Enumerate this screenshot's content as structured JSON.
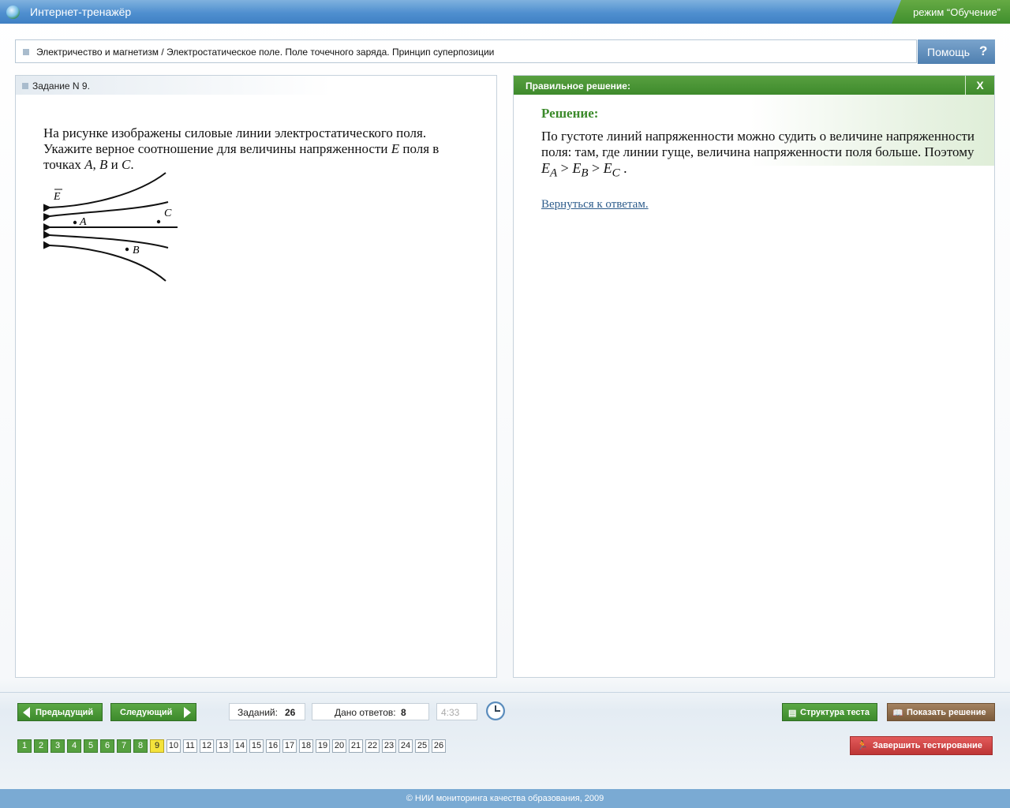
{
  "app": {
    "title": "Интернет-тренажёр",
    "mode": "режим “Обучение”"
  },
  "breadcrumb": {
    "text": "Электричество и магнетизм / Электростатическое поле. Поле точечного заряда. Принцип суперпозиции"
  },
  "help": {
    "label": "Помощь",
    "icon": "question-icon",
    "icon_text": "?"
  },
  "task": {
    "header": "Задание N 9.",
    "question": {
      "p1": "На рисунке изображены силовые линии электростатического поля. Укажите верное соотношение для величины напряженности ",
      "E": "E",
      "p2": " поля в точках ",
      "A": "A",
      "comma": ", ",
      "B": "B",
      "and": " и ",
      "C": "C",
      "end": "."
    },
    "figure": {
      "vector_label": "E",
      "points": {
        "A": "A",
        "B": "B",
        "C": "C"
      }
    }
  },
  "solution": {
    "header": "Правильное решение:",
    "close": "X",
    "title": "Решение:",
    "text": "По густоте линий напряженности можно судить о величине напряженности поля: там, где линии гуще, величина напряженности поля больше. Поэтому ",
    "formula": {
      "E": "E",
      "sub_a": "A",
      "sub_b": "B",
      "sub_c": "C",
      "gt": " > ",
      "end": " ."
    },
    "back_link": "Вернуться к ответам."
  },
  "toolbar": {
    "prev": "Предыдущий",
    "next": "Следующий",
    "tasks_label": "Заданий:",
    "tasks_count": "26",
    "answers_label": "Дано ответов:",
    "answers_count": "8",
    "timer": "4:33",
    "structure": "Структура теста",
    "show_solution": "Показать решение",
    "finish": "Завершить тестирование"
  },
  "questions": {
    "numbers": [
      "1",
      "2",
      "3",
      "4",
      "5",
      "6",
      "7",
      "8",
      "9",
      "10",
      "11",
      "12",
      "13",
      "14",
      "15",
      "16",
      "17",
      "18",
      "19",
      "20",
      "21",
      "22",
      "23",
      "24",
      "25",
      "26"
    ],
    "answered": 8,
    "current": 9
  },
  "footer": {
    "copyright": "© НИИ мониторинга качества образования, 2009"
  },
  "colors": {
    "titlebar": "#4f8fcf",
    "mode_tab": "#4a9a35",
    "green_header": "#4a9535",
    "current_question": "#f4e33c",
    "answered_question": "#56a040",
    "finish_button": "#d04646"
  }
}
